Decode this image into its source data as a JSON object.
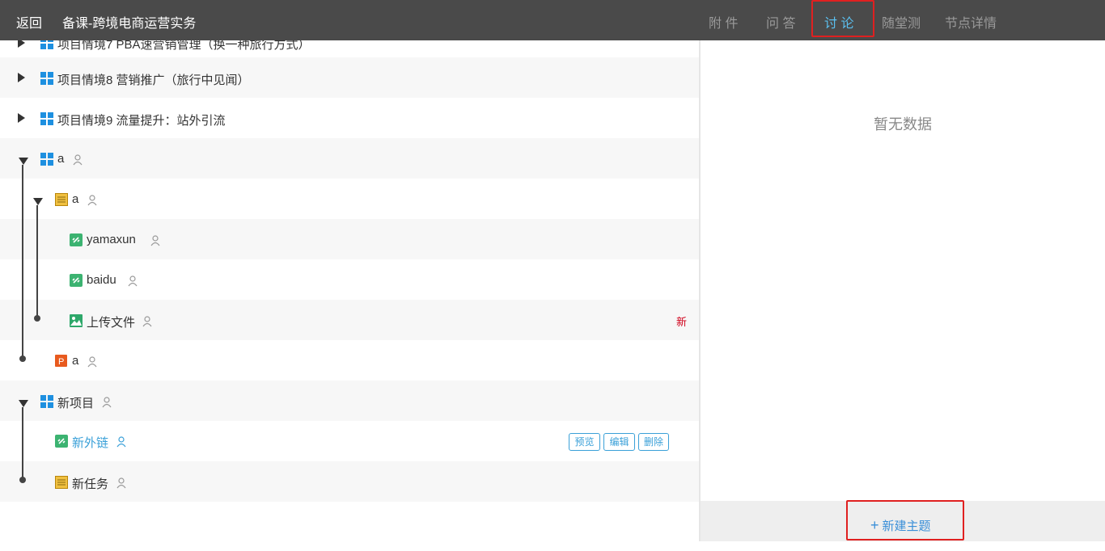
{
  "header": {
    "back_label": "返回",
    "course_title": "备课-跨境电商运营实务",
    "tabs": [
      "附 件",
      "问 答",
      "讨 论",
      "随堂测",
      "节点详情"
    ],
    "active_tab": "讨 论"
  },
  "tree": {
    "items": [
      {
        "label": "项目情境7 PBA速营销管理（换一种旅行方式）"
      },
      {
        "label": "项目情境8 营销推广（旅行中见闻）"
      },
      {
        "label": "项目情境9 流量提升：站外引流"
      },
      {
        "label": "a"
      },
      {
        "label": "a"
      },
      {
        "label": "yamaxun"
      },
      {
        "label": "baidu"
      },
      {
        "label": "上传文件",
        "badge": "新"
      },
      {
        "label": "a"
      },
      {
        "label": "新项目"
      },
      {
        "label": "新外链",
        "actions": [
          "预览",
          "编辑",
          "删除"
        ]
      },
      {
        "label": "新任务"
      }
    ]
  },
  "panel": {
    "empty_text": "暂无数据",
    "new_topic_label": "新建主题"
  },
  "colors": {
    "header_bg": "#4a4a4a",
    "active_tab": "#5bc0f0",
    "link": "#3aa0d8",
    "highlight": "#e02020",
    "badge": "#d0021b"
  }
}
